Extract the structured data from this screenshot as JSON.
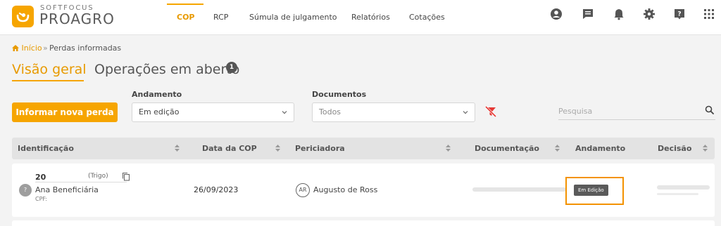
{
  "header": {
    "brand_top": "SOFTFOCUS",
    "brand_main": "PROAGRO",
    "nav": [
      {
        "label": "COP",
        "active": true
      },
      {
        "label": "RCP",
        "active": false
      },
      {
        "label": "Súmula de julgamento",
        "active": false
      },
      {
        "label": "Relatórios",
        "active": false
      },
      {
        "label": "Cotações",
        "active": false
      }
    ],
    "icons": [
      "account-icon",
      "chat-icon",
      "bell-icon",
      "gear-icon",
      "help-icon",
      "apps-grid-icon"
    ]
  },
  "breadcrumb": {
    "home": "Início",
    "separator": "»",
    "current": "Perdas informadas"
  },
  "tabs": {
    "active": "Visão geral",
    "inactive": "Operações em aberto",
    "badge": "1"
  },
  "filters": {
    "primary_button": "Informar nova perda",
    "andamento_label": "Andamento",
    "andamento_value": "Em edição",
    "documentos_label": "Documentos",
    "documentos_value": "Todos",
    "search_placeholder": "Pesquisa"
  },
  "table": {
    "columns": [
      "Identificação",
      "Data da COP",
      "Periciadora",
      "Documentação",
      "Andamento",
      "Decisão"
    ],
    "rows": [
      {
        "id": "20",
        "type": "(Trigo)",
        "beneficiary_initial": "?",
        "beneficiary": "Ana Beneficiária",
        "cpf_label": "CPF:",
        "date": "26/09/2023",
        "perito_initials": "AR",
        "perito": "Augusto de Ross",
        "status": "Em Edição"
      }
    ]
  },
  "colors": {
    "accent": "#f6a500",
    "highlight": "#f39200",
    "status_badge": "#5a5a5a"
  }
}
